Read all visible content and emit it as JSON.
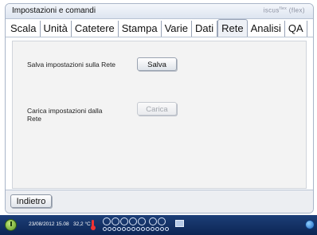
{
  "window": {
    "title": "Impostazioni e comandi",
    "brand": "iscusᴾˡᵘˢ (flex)"
  },
  "tabs": [
    {
      "label": "Scala",
      "active": false
    },
    {
      "label": "Unità",
      "active": false
    },
    {
      "label": "Catetere",
      "active": false
    },
    {
      "label": "Stampa",
      "active": false
    },
    {
      "label": "Varie",
      "active": false
    },
    {
      "label": "Dati",
      "active": false
    },
    {
      "label": "Rete",
      "active": true
    },
    {
      "label": "Analisi",
      "active": false
    },
    {
      "label": "QA",
      "active": false
    }
  ],
  "content": {
    "save_label": "Salva impostazioni sulla Rete",
    "save_button": "Salva",
    "load_label": "Carica impostazioni dalla Rete",
    "load_button": "Carica",
    "load_button_enabled": false
  },
  "footer": {
    "back_button": "Indietro"
  },
  "status": {
    "datetime": "23/08/2012 15.08",
    "temperature": "32,2 °C",
    "power_icon": "power-icon",
    "thermometer_icon": "thermometer-icon",
    "network_icon": "network-icon",
    "globe_icon": "globe-icon"
  }
}
